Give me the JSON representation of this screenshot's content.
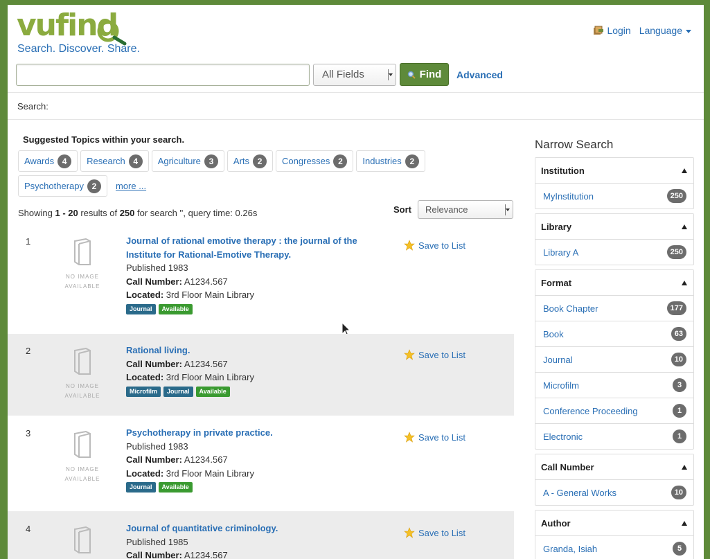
{
  "header": {
    "logo_vu": "vu",
    "logo_find": "find",
    "tagline": "Search. Discover. Share.",
    "login": "Login",
    "language": "Language"
  },
  "search": {
    "query": "",
    "placeholder": "",
    "type_selected": "All Fields",
    "find_label": "Find",
    "advanced_label": "Advanced"
  },
  "breadcrumb": "Search:",
  "suggested": {
    "title": "Suggested Topics within your search.",
    "topics": [
      {
        "label": "Awards",
        "count": "4"
      },
      {
        "label": "Research",
        "count": "4"
      },
      {
        "label": "Agriculture",
        "count": "3"
      },
      {
        "label": "Arts",
        "count": "2"
      },
      {
        "label": "Congresses",
        "count": "2"
      },
      {
        "label": "Industries",
        "count": "2"
      },
      {
        "label": "Psychotherapy",
        "count": "2"
      }
    ],
    "more": "more ..."
  },
  "results_summary": {
    "prefix": "Showing ",
    "range": "1 - 20",
    "mid": " results of ",
    "total": "250",
    "suffix": " for search '', query time: 0.26s"
  },
  "sort": {
    "label": "Sort",
    "selected": "Relevance"
  },
  "no_image": {
    "line1": "NO IMAGE",
    "line2": "AVAILABLE"
  },
  "save_label": "Save to List",
  "field_labels": {
    "call_number": "Call Number:",
    "located": "Located:"
  },
  "results": [
    {
      "num": "1",
      "title_line1": "Journal of rational emotive therapy : the journal of the",
      "title_line2": "Institute for Rational-Emotive Therapy.",
      "published": "Published 1983",
      "call_number": "A1234.567",
      "located": "3rd Floor Main Library",
      "tags": [
        "Journal",
        "Available"
      ]
    },
    {
      "num": "2",
      "title_line1": "Rational living.",
      "call_number": "A1234.567",
      "located": "3rd Floor Main Library",
      "tags": [
        "Microfilm",
        "Journal",
        "Available"
      ]
    },
    {
      "num": "3",
      "title_line1": "Psychotherapy in private practice.",
      "published": "Published 1983",
      "call_number": "A1234.567",
      "located": "3rd Floor Main Library",
      "tags": [
        "Journal",
        "Available"
      ]
    },
    {
      "num": "4",
      "title_line1": "Journal of quantitative criminology.",
      "published": "Published 1985",
      "call_number": "A1234.567"
    }
  ],
  "sidebar": {
    "title": "Narrow Search",
    "facets": [
      {
        "name": "Institution",
        "items": [
          {
            "label": "MyInstitution",
            "count": "250"
          }
        ]
      },
      {
        "name": "Library",
        "items": [
          {
            "label": "Library A",
            "count": "250"
          }
        ]
      },
      {
        "name": "Format",
        "items": [
          {
            "label": "Book Chapter",
            "count": "177"
          },
          {
            "label": "Book",
            "count": "63"
          },
          {
            "label": "Journal",
            "count": "10"
          },
          {
            "label": "Microfilm",
            "count": "3"
          },
          {
            "label": "Conference Proceeding",
            "count": "1"
          },
          {
            "label": "Electronic",
            "count": "1"
          }
        ]
      },
      {
        "name": "Call Number",
        "items": [
          {
            "label": "A - General Works",
            "count": "10"
          }
        ]
      },
      {
        "name": "Author",
        "items": [
          {
            "label": "Granda, Isiah",
            "count": "5"
          }
        ]
      }
    ]
  },
  "colors": {
    "brand_green": "#5e8a3a",
    "logo_green": "#8bab3f",
    "link_blue": "#2a6fb5"
  }
}
